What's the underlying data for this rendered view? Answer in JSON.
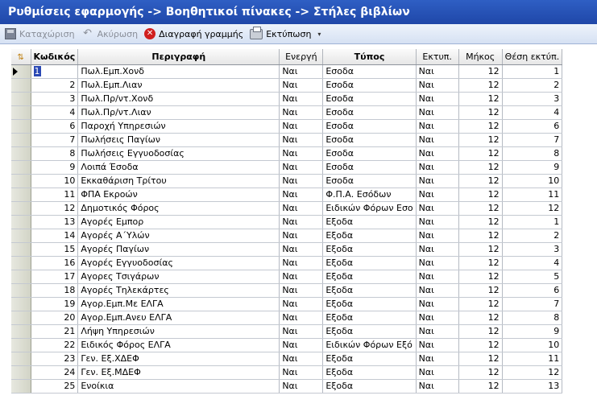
{
  "window": {
    "title": "Ρυθμίσεις εφαρμογής -> Βοηθητικοί πίνακες -> Στήλες βιβλίων"
  },
  "toolbar": {
    "save": {
      "label": "Καταχώριση",
      "icon": "save-icon"
    },
    "cancel": {
      "label": "Ακύρωση",
      "icon": "undo-icon"
    },
    "delete_row": {
      "label": "Διαγραφή γραμμής",
      "icon": "delete-icon"
    },
    "print": {
      "label": "Εκτύπωση",
      "icon": "printer-icon"
    },
    "dropdown_arrow": "▾"
  },
  "grid": {
    "header_icon": "⇅",
    "columns": [
      "Κωδικός",
      "Περιγραφή",
      "Ενεργή",
      "Τύπος",
      "Εκτυπ.",
      "Μήκος",
      "Θέση εκτύπ."
    ],
    "rows": [
      {
        "code": "1",
        "desc": "Πωλ.Εμπ.Χονδ",
        "active": "Ναι",
        "type": "Εσοδα",
        "print": "Ναι",
        "length": "12",
        "pos": "1"
      },
      {
        "code": "2",
        "desc": "Πωλ.Εμπ.Λιαν",
        "active": "Ναι",
        "type": "Εσοδα",
        "print": "Ναι",
        "length": "12",
        "pos": "2"
      },
      {
        "code": "3",
        "desc": "Πωλ.Πρ/ντ.Χονδ",
        "active": "Ναι",
        "type": "Εσοδα",
        "print": "Ναι",
        "length": "12",
        "pos": "3"
      },
      {
        "code": "4",
        "desc": "Πωλ.Πρ/ντ.Λιαν",
        "active": "Ναι",
        "type": "Εσοδα",
        "print": "Ναι",
        "length": "12",
        "pos": "4"
      },
      {
        "code": "6",
        "desc": "Παροχή Υπηρεσιών",
        "active": "Ναι",
        "type": "Εσοδα",
        "print": "Ναι",
        "length": "12",
        "pos": "6"
      },
      {
        "code": "7",
        "desc": "Πωλήσεις Παγίων",
        "active": "Ναι",
        "type": "Εσοδα",
        "print": "Ναι",
        "length": "12",
        "pos": "7"
      },
      {
        "code": "8",
        "desc": "Πωλήσεις Εγγυοδοσίας",
        "active": "Ναι",
        "type": "Εσοδα",
        "print": "Ναι",
        "length": "12",
        "pos": "8"
      },
      {
        "code": "9",
        "desc": "Λοιπά Έσοδα",
        "active": "Ναι",
        "type": "Εσοδα",
        "print": "Ναι",
        "length": "12",
        "pos": "9"
      },
      {
        "code": "10",
        "desc": "Εκκαθάριση Τρίτου",
        "active": "Ναι",
        "type": "Εσοδα",
        "print": "Ναι",
        "length": "12",
        "pos": "10"
      },
      {
        "code": "11",
        "desc": "ΦΠΑ Εκροών",
        "active": "Ναι",
        "type": "Φ.Π.Α. Εσόδων",
        "print": "Ναι",
        "length": "12",
        "pos": "11"
      },
      {
        "code": "12",
        "desc": "Δημοτικός Φόρος",
        "active": "Ναι",
        "type": "Ειδικών Φόρων Εσο",
        "print": "Ναι",
        "length": "12",
        "pos": "12"
      },
      {
        "code": "13",
        "desc": "Αγορές Εμπορ",
        "active": "Ναι",
        "type": "Εξοδα",
        "print": "Ναι",
        "length": "12",
        "pos": "1"
      },
      {
        "code": "14",
        "desc": "Αγορές Α΄Υλών",
        "active": "Ναι",
        "type": "Εξοδα",
        "print": "Ναι",
        "length": "12",
        "pos": "2"
      },
      {
        "code": "15",
        "desc": "Αγορές Παγίων",
        "active": "Ναι",
        "type": "Εξοδα",
        "print": "Ναι",
        "length": "12",
        "pos": "3"
      },
      {
        "code": "16",
        "desc": "Αγορές Εγγυοδοσίας",
        "active": "Ναι",
        "type": "Εξοδα",
        "print": "Ναι",
        "length": "12",
        "pos": "4"
      },
      {
        "code": "17",
        "desc": "Αγορες Τσιγάρων",
        "active": "Ναι",
        "type": "Εξοδα",
        "print": "Ναι",
        "length": "12",
        "pos": "5"
      },
      {
        "code": "18",
        "desc": "Αγορές Τηλεκάρτες",
        "active": "Ναι",
        "type": "Εξοδα",
        "print": "Ναι",
        "length": "12",
        "pos": "6"
      },
      {
        "code": "19",
        "desc": "Αγορ.Εμπ.Με ΕΛΓΑ",
        "active": "Ναι",
        "type": "Εξοδα",
        "print": "Ναι",
        "length": "12",
        "pos": "7"
      },
      {
        "code": "20",
        "desc": "Αγορ.Εμπ.Ανευ ΕΛΓΑ",
        "active": "Ναι",
        "type": "Εξοδα",
        "print": "Ναι",
        "length": "12",
        "pos": "8"
      },
      {
        "code": "21",
        "desc": "Λήψη Υπηρεσιών",
        "active": "Ναι",
        "type": "Εξοδα",
        "print": "Ναι",
        "length": "12",
        "pos": "9"
      },
      {
        "code": "22",
        "desc": "Ειδικός Φόρος ΕΛΓΑ",
        "active": "Ναι",
        "type": "Ειδικών Φόρων Εξό",
        "print": "Ναι",
        "length": "12",
        "pos": "10"
      },
      {
        "code": "23",
        "desc": "Γεν. Εξ.ΧΔΕΦ",
        "active": "Ναι",
        "type": "Εξοδα",
        "print": "Ναι",
        "length": "12",
        "pos": "11"
      },
      {
        "code": "24",
        "desc": "Γεν. Εξ.ΜΔΕΦ",
        "active": "Ναι",
        "type": "Εξοδα",
        "print": "Ναι",
        "length": "12",
        "pos": "12"
      },
      {
        "code": "25",
        "desc": "Ενοίκια",
        "active": "Ναι",
        "type": "Εξοδα",
        "print": "Ναι",
        "length": "12",
        "pos": "13"
      }
    ]
  }
}
